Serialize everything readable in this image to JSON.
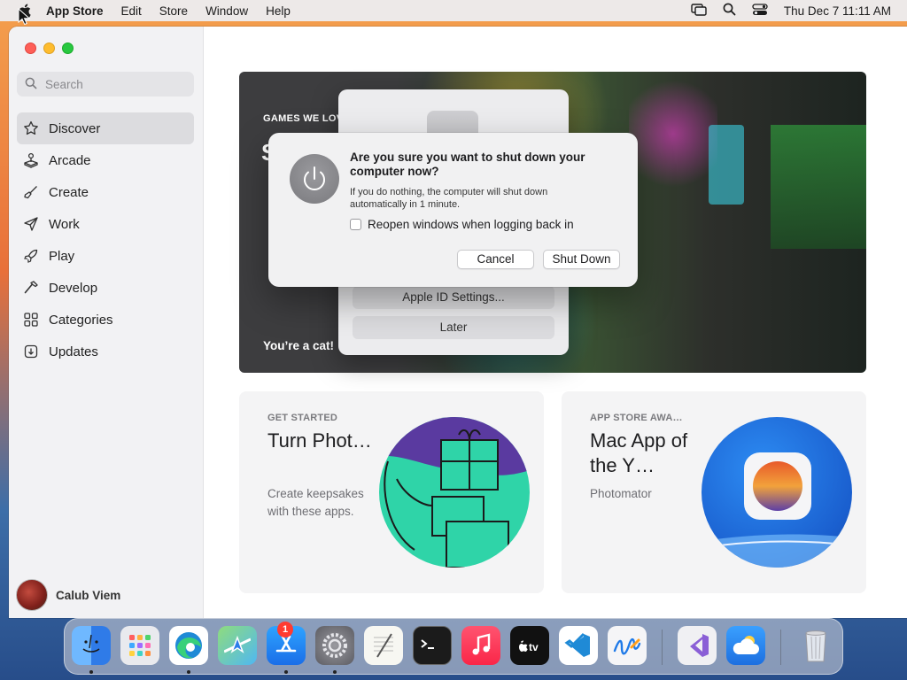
{
  "menubar": {
    "app_name": "App Store",
    "menus": [
      "Edit",
      "Store",
      "Window",
      "Help"
    ],
    "clock": "Thu Dec 7  11:11 AM"
  },
  "sidebar": {
    "search_placeholder": "Search",
    "items": [
      {
        "label": "Discover",
        "icon": "star-icon",
        "active": true
      },
      {
        "label": "Arcade",
        "icon": "joystick-icon"
      },
      {
        "label": "Create",
        "icon": "brush-icon"
      },
      {
        "label": "Work",
        "icon": "paperplane-icon"
      },
      {
        "label": "Play",
        "icon": "rocket-icon"
      },
      {
        "label": "Develop",
        "icon": "hammer-icon"
      },
      {
        "label": "Categories",
        "icon": "grid-icon"
      },
      {
        "label": "Updates",
        "icon": "download-icon"
      }
    ],
    "user_name": "Calub Viem"
  },
  "hero": {
    "eyebrow": "GAMES WE LOV",
    "title_fragment": "S",
    "tagline": "You’re a cat!"
  },
  "cards": [
    {
      "kicker": "GET STARTED",
      "title": "Turn Phot…",
      "description": "Create keepsakes with these apps."
    },
    {
      "kicker": "APP STORE AWA…",
      "title": "Mac App of the Y…",
      "description": "Photomator"
    }
  ],
  "apple_id_sheet": {
    "button_settings": "Apple ID Settings...",
    "button_later": "Later"
  },
  "shutdown_alert": {
    "title": "Are you sure you want to shut down your computer now?",
    "message": "If you do nothing, the computer will shut down automatically in 1 minute.",
    "checkbox_label": "Reopen windows when logging back in",
    "checkbox_checked": false,
    "cancel_label": "Cancel",
    "confirm_label": "Shut Down"
  },
  "dock": {
    "settings_badge": "1",
    "apps": [
      "Finder",
      "Launchpad",
      "Microsoft Edge",
      "Maps",
      "App Store",
      "System Settings",
      "TextEdit",
      "Terminal",
      "Music",
      "TV",
      "Visual Studio Code",
      "Freeform",
      "Visual Studio",
      "Weather",
      "Trash"
    ]
  }
}
